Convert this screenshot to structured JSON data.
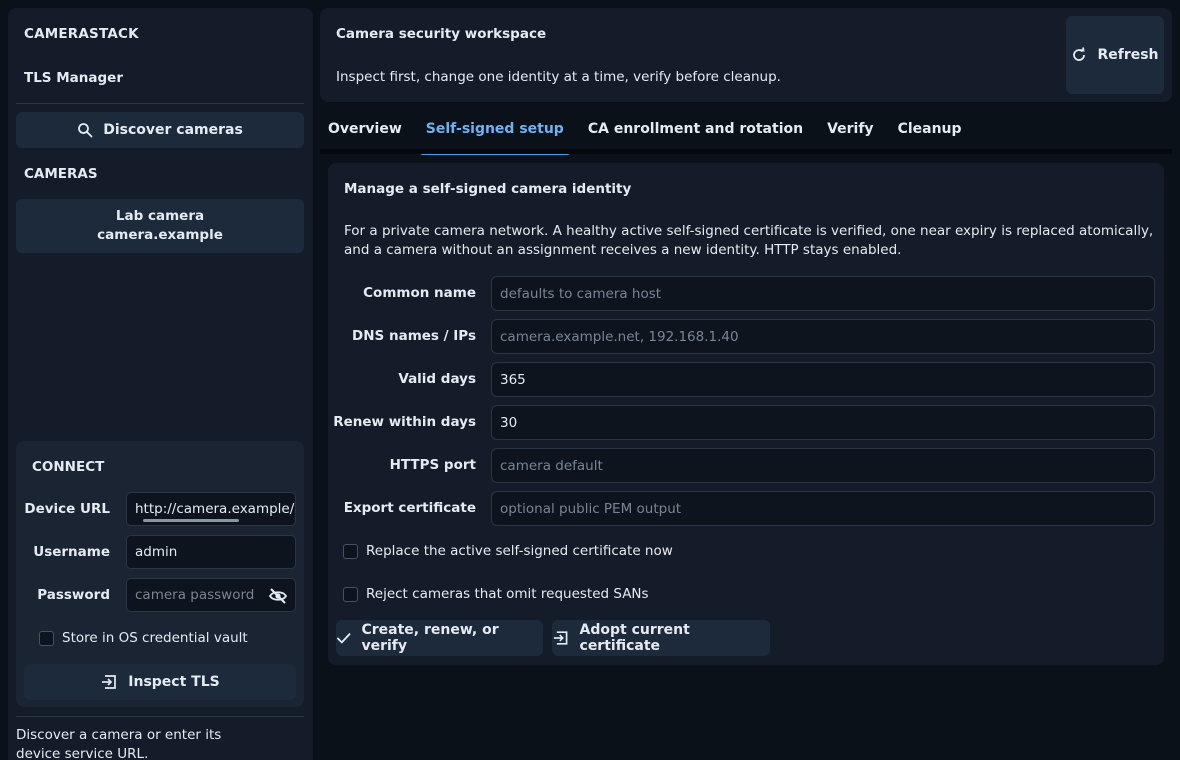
{
  "sidebar": {
    "brand": "CAMERASTACK",
    "subtitle": "TLS Manager",
    "discover_label": "Discover cameras",
    "cameras_heading": "CAMERAS",
    "camera": {
      "name": "Lab camera",
      "host": "camera.example"
    },
    "connect": {
      "title": "CONNECT",
      "device_url_label": "Device URL",
      "device_url_value": "http://camera.example/o",
      "username_label": "Username",
      "username_value": "admin",
      "password_label": "Password",
      "password_placeholder": "camera password",
      "store_label": "Store in OS credential vault",
      "inspect_label": "Inspect TLS"
    },
    "hint": "Discover a camera or enter its device service URL."
  },
  "header": {
    "title": "Camera security workspace",
    "subtitle": "Inspect first, change one identity at a time, verify before cleanup.",
    "refresh_label": "Refresh"
  },
  "tabs": [
    {
      "label": "Overview"
    },
    {
      "label": "Self-signed setup"
    },
    {
      "label": "CA enrollment and rotation"
    },
    {
      "label": "Verify"
    },
    {
      "label": "Cleanup"
    }
  ],
  "panel": {
    "title": "Manage a self-signed camera identity",
    "description": "For a private camera network. A healthy active self-signed certificate is verified, one near expiry is replaced atomically, and a camera without an assignment receives a new identity. HTTP stays enabled.",
    "fields": {
      "common_name": {
        "label": "Common name",
        "placeholder": "defaults to camera host"
      },
      "dns_names": {
        "label": "DNS names / IPs",
        "placeholder": "camera.example.net, 192.168.1.40"
      },
      "valid_days": {
        "label": "Valid days",
        "value": "365"
      },
      "renew_within": {
        "label": "Renew within days",
        "value": "30"
      },
      "https_port": {
        "label": "HTTPS port",
        "placeholder": "camera default"
      },
      "export_cert": {
        "label": "Export certificate",
        "placeholder": "optional public PEM output"
      }
    },
    "replace_label": "Replace the active self-signed certificate now",
    "reject_label": "Reject cameras that omit requested SANs",
    "create_label": "Create, renew, or verify",
    "adopt_label": "Adopt current certificate"
  },
  "colors": {
    "accent": "#4a9df0",
    "background": "#0b1119",
    "card": "#131c28"
  }
}
